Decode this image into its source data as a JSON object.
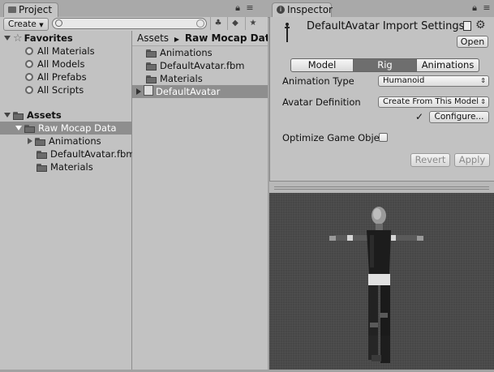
{
  "project": {
    "tab_label": "Project",
    "create_label": "Create",
    "favorites": {
      "header": "Favorites",
      "items": [
        "All Materials",
        "All Models",
        "All Prefabs",
        "All Scripts"
      ]
    },
    "assets": {
      "header": "Assets",
      "tree": [
        {
          "label": "Raw Mocap Data",
          "selected": true
        },
        {
          "label": "Animations"
        },
        {
          "label": "DefaultAvatar.fbm"
        },
        {
          "label": "Materials"
        }
      ]
    },
    "breadcrumb": {
      "root": "Assets",
      "separator": "▶",
      "current": "Raw Mocap Data"
    },
    "files": [
      {
        "label": "Animations",
        "icon": "folder-icon"
      },
      {
        "label": "DefaultAvatar.fbm",
        "icon": "folder-icon"
      },
      {
        "label": "Materials",
        "icon": "folder-icon"
      },
      {
        "label": "DefaultAvatar",
        "icon": "model-prefab-icon",
        "selected": true
      }
    ]
  },
  "inspector": {
    "tab_label": "Inspector",
    "title": "DefaultAvatar Import Settings",
    "open_label": "Open",
    "tabs": [
      {
        "label": "Model"
      },
      {
        "label": "Rig",
        "active": true
      },
      {
        "label": "Animations"
      }
    ],
    "animation_type": {
      "label": "Animation Type",
      "value": "Humanoid"
    },
    "avatar_definition": {
      "label": "Avatar Definition",
      "value": "Create From This Model"
    },
    "configure_label": "Configure...",
    "check_mark": "✓",
    "optimize_label": "Optimize Game Obje",
    "revert_label": "Revert",
    "apply_label": "Apply"
  }
}
